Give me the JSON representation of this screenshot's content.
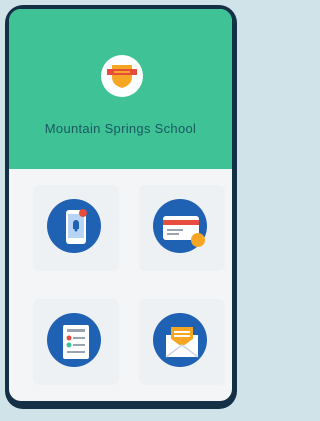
{
  "app": {
    "school_name": "Mountain Springs School"
  },
  "colors": {
    "header": "#3fc296",
    "phone_frame": "#133046",
    "icon_circle": "#1f62b3",
    "accent_orange": "#f6a623",
    "accent_red": "#e74c3c"
  },
  "icons": [
    "mobile-notification-icon",
    "credit-card-icon",
    "checklist-document-icon",
    "email-icon"
  ]
}
